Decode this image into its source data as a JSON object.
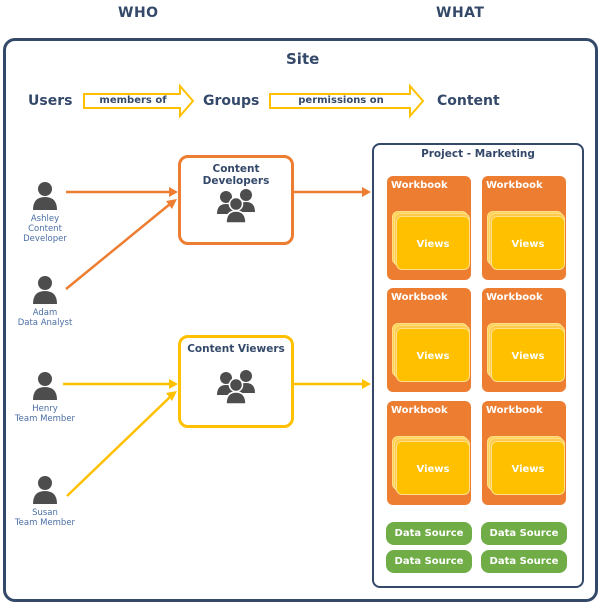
{
  "headers": {
    "who": "WHO",
    "what": "WHAT"
  },
  "site": {
    "title": "Site",
    "flow": {
      "users": "Users",
      "members_of": "members of",
      "groups": "Groups",
      "permissions_on": "permissions on",
      "content": "Content"
    }
  },
  "users": [
    {
      "name": "Ashley",
      "role": "Content Developer",
      "icon": "person-icon"
    },
    {
      "name": "Adam",
      "role": "Data Analyst",
      "icon": "person-icon"
    },
    {
      "name": "Henry",
      "role": "Team Member",
      "icon": "person-icon"
    },
    {
      "name": "Susan",
      "role": "Team Member",
      "icon": "person-icon"
    }
  ],
  "groups": [
    {
      "title": "Content Developers",
      "icon": "group-icon",
      "color": "#ed7d31"
    },
    {
      "title": "Content Viewers",
      "icon": "group-icon",
      "color": "#ffc000"
    }
  ],
  "project": {
    "title": "Project - Marketing",
    "workbooks": [
      {
        "title": "Workbook",
        "views": "Views"
      },
      {
        "title": "Workbook",
        "views": "Views"
      },
      {
        "title": "Workbook",
        "views": "Views"
      },
      {
        "title": "Workbook",
        "views": "Views"
      },
      {
        "title": "Workbook",
        "views": "Views"
      },
      {
        "title": "Workbook",
        "views": "Views"
      }
    ],
    "data_sources": [
      "Data Source",
      "Data Source",
      "Data Source",
      "Data Source"
    ]
  },
  "colors": {
    "navy": "#34496a",
    "orange": "#ed7d31",
    "yellow": "#ffc000",
    "green": "#70ad47",
    "person": "#4d4d4d",
    "user_text": "#4a6fa5"
  }
}
